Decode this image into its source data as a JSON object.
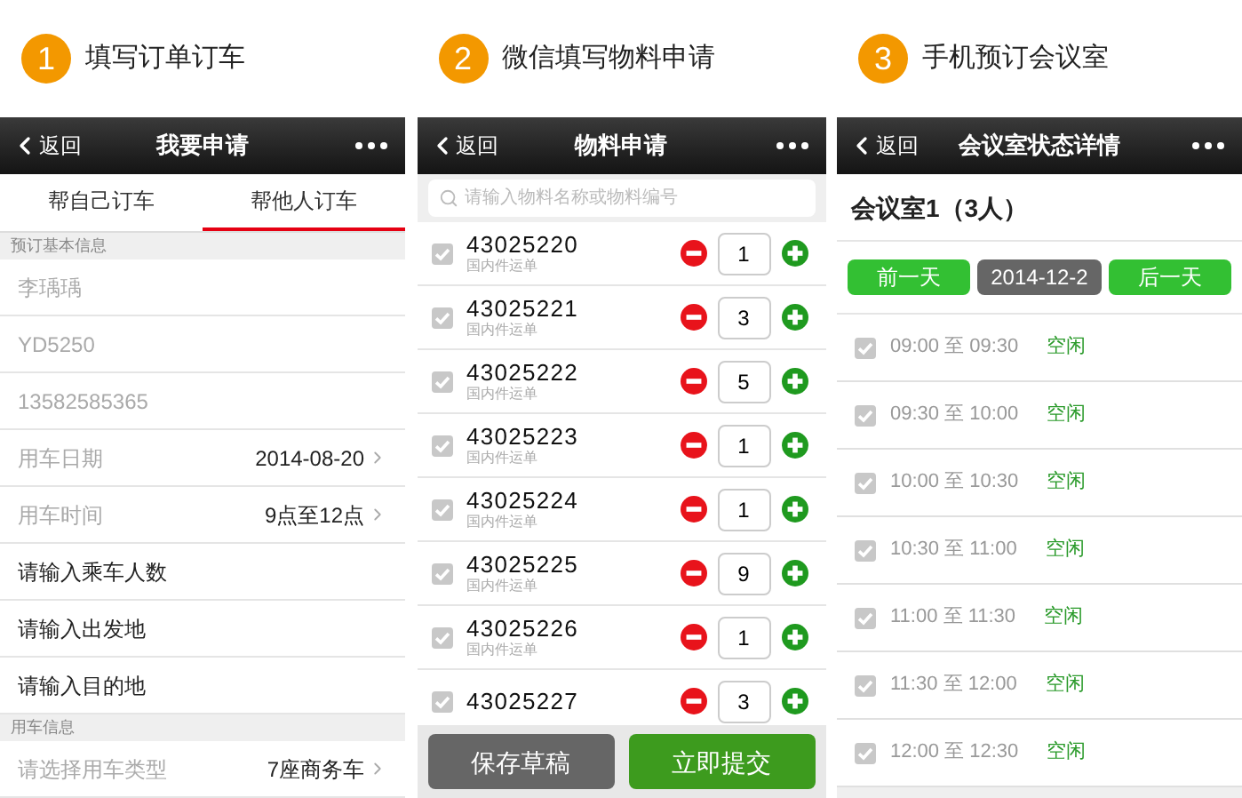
{
  "panels": [
    {
      "step": "1",
      "caption": "填写订单订车",
      "screen": {
        "back": "返回",
        "title": "我要申请",
        "tabs": [
          {
            "label": "帮自己订车",
            "selected": false
          },
          {
            "label": "帮他人订车",
            "selected": true
          }
        ],
        "sections": [
          {
            "header": "预订基本信息",
            "rows": [
              {
                "kind": "value",
                "label": "李瑀瑀"
              },
              {
                "kind": "value",
                "label": "YD5250"
              },
              {
                "kind": "value",
                "label": "13582585365"
              },
              {
                "kind": "picker",
                "label": "用车日期",
                "value": "2014-08-20"
              },
              {
                "kind": "picker",
                "label": "用车时间",
                "value": "9点至12点"
              },
              {
                "kind": "input",
                "label": "请输入乘车人数"
              },
              {
                "kind": "input",
                "label": "请输入出发地"
              },
              {
                "kind": "input",
                "label": "请输入目的地"
              }
            ]
          },
          {
            "header": "用车信息",
            "rows": [
              {
                "kind": "picker",
                "label": "请选择用车类型",
                "value": "7座商务车"
              }
            ]
          }
        ]
      }
    },
    {
      "step": "2",
      "caption": "微信填写物料申请",
      "screen": {
        "back": "返回",
        "title": "物料申请",
        "search": {
          "placeholder": "请输入物料名称或物料编号"
        },
        "items": [
          {
            "code": "43025220",
            "subtitle": "国内件运单",
            "checked": true,
            "qty": "1"
          },
          {
            "code": "43025221",
            "subtitle": "国内件运单",
            "checked": true,
            "qty": "3"
          },
          {
            "code": "43025222",
            "subtitle": "国内件运单",
            "checked": true,
            "qty": "5"
          },
          {
            "code": "43025223",
            "subtitle": "国内件运单",
            "checked": true,
            "qty": "1"
          },
          {
            "code": "43025224",
            "subtitle": "国内件运单",
            "checked": true,
            "qty": "1"
          },
          {
            "code": "43025225",
            "subtitle": "国内件运单",
            "checked": true,
            "qty": "9"
          },
          {
            "code": "43025226",
            "subtitle": "国内件运单",
            "checked": true,
            "qty": "1"
          },
          {
            "code": "43025227",
            "checked": true,
            "qty": "3"
          }
        ],
        "buttons": [
          {
            "label": "保存草稿",
            "kind": "secondary"
          },
          {
            "label": "立即提交",
            "kind": "primary"
          }
        ]
      }
    },
    {
      "step": "3",
      "caption": "手机预订会议室",
      "screen": {
        "back": "返回",
        "title": "会议室状态详情",
        "room": "会议室1（3人）",
        "date_nav": [
          {
            "label": "前一天",
            "kind": "button"
          },
          {
            "label": "2014-12-2",
            "kind": "date"
          },
          {
            "label": "后一天",
            "kind": "button"
          }
        ],
        "slots": [
          {
            "time": "09:00 至 09:30",
            "status": "空闲",
            "checked": true
          },
          {
            "time": "09:30 至 10:00",
            "status": "空闲",
            "checked": true
          },
          {
            "time": "10:00 至 10:30",
            "status": "空闲",
            "checked": true
          },
          {
            "time": "10:30 至 11:00",
            "status": "空闲",
            "checked": true
          },
          {
            "time": "11:00 至 11:30",
            "status": "空闲",
            "checked": true
          },
          {
            "time": "11:30 至 12:00",
            "status": "空闲",
            "checked": true
          },
          {
            "time": "12:00 至 12:30",
            "status": "空闲",
            "checked": true
          }
        ]
      }
    }
  ]
}
